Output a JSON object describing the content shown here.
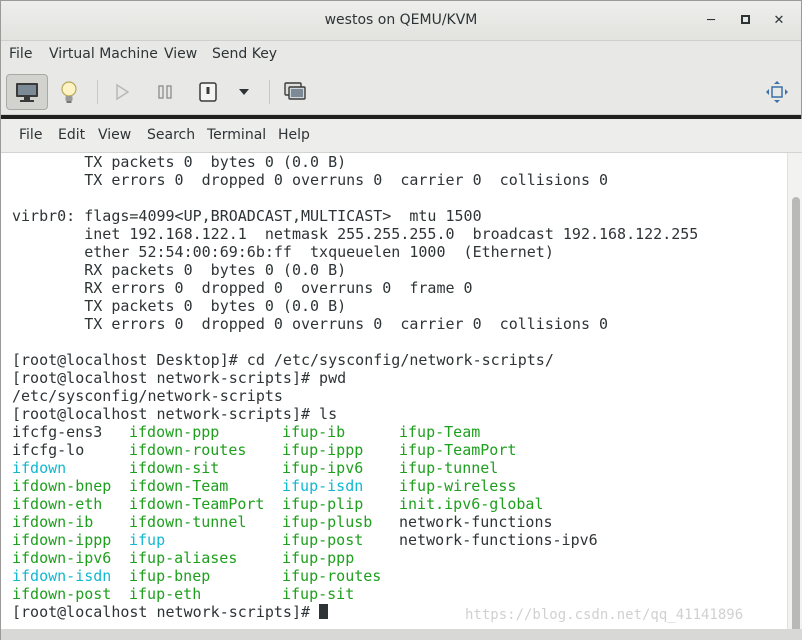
{
  "window": {
    "title": "westos on QEMU/KVM"
  },
  "menubar": {
    "items": [
      "File",
      "Virtual Machine",
      "View",
      "Send Key"
    ]
  },
  "terminal": {
    "menu": [
      "File",
      "Edit",
      "View",
      "Search",
      "Terminal",
      "Help"
    ],
    "lines": [
      "        TX packets 0  bytes 0 (0.0 B)",
      "        TX errors 0  dropped 0 overruns 0  carrier 0  collisions 0",
      "",
      "virbr0: flags=4099<UP,BROADCAST,MULTICAST>  mtu 1500",
      "        inet 192.168.122.1  netmask 255.255.255.0  broadcast 192.168.122.255",
      "        ether 52:54:00:69:6b:ff  txqueuelen 1000  (Ethernet)",
      "        RX packets 0  bytes 0 (0.0 B)",
      "        RX errors 0  dropped 0  overruns 0  frame 0",
      "        TX packets 0  bytes 0 (0.0 B)",
      "        TX errors 0  dropped 0 overruns 0  carrier 0  collisions 0",
      "",
      "[root@localhost Desktop]# cd /etc/sysconfig/network-scripts/",
      "[root@localhost network-scripts]# pwd",
      "/etc/sysconfig/network-scripts",
      "[root@localhost network-scripts]# ls"
    ],
    "ls_rows": [
      [
        {
          "t": "ifcfg-ens3",
          "c": "plain"
        },
        {
          "t": "ifdown-ppp",
          "c": "green"
        },
        {
          "t": "ifup-ib",
          "c": "green"
        },
        {
          "t": "ifup-Team",
          "c": "green"
        }
      ],
      [
        {
          "t": "ifcfg-lo",
          "c": "plain"
        },
        {
          "t": "ifdown-routes",
          "c": "green"
        },
        {
          "t": "ifup-ippp",
          "c": "green"
        },
        {
          "t": "ifup-TeamPort",
          "c": "green"
        }
      ],
      [
        {
          "t": "ifdown",
          "c": "cyan"
        },
        {
          "t": "ifdown-sit",
          "c": "green"
        },
        {
          "t": "ifup-ipv6",
          "c": "green"
        },
        {
          "t": "ifup-tunnel",
          "c": "green"
        }
      ],
      [
        {
          "t": "ifdown-bnep",
          "c": "green"
        },
        {
          "t": "ifdown-Team",
          "c": "green"
        },
        {
          "t": "ifup-isdn",
          "c": "cyan"
        },
        {
          "t": "ifup-wireless",
          "c": "green"
        }
      ],
      [
        {
          "t": "ifdown-eth",
          "c": "green"
        },
        {
          "t": "ifdown-TeamPort",
          "c": "green"
        },
        {
          "t": "ifup-plip",
          "c": "green"
        },
        {
          "t": "init.ipv6-global",
          "c": "green"
        }
      ],
      [
        {
          "t": "ifdown-ib",
          "c": "green"
        },
        {
          "t": "ifdown-tunnel",
          "c": "green"
        },
        {
          "t": "ifup-plusb",
          "c": "green"
        },
        {
          "t": "network-functions",
          "c": "plain"
        }
      ],
      [
        {
          "t": "ifdown-ippp",
          "c": "green"
        },
        {
          "t": "ifup",
          "c": "cyan"
        },
        {
          "t": "ifup-post",
          "c": "green"
        },
        {
          "t": "network-functions-ipv6",
          "c": "plain"
        }
      ],
      [
        {
          "t": "ifdown-ipv6",
          "c": "green"
        },
        {
          "t": "ifup-aliases",
          "c": "green"
        },
        {
          "t": "ifup-ppp",
          "c": "green"
        },
        {
          "t": "",
          "c": "plain"
        }
      ],
      [
        {
          "t": "ifdown-isdn",
          "c": "cyan"
        },
        {
          "t": "ifup-bnep",
          "c": "green"
        },
        {
          "t": "ifup-routes",
          "c": "green"
        },
        {
          "t": "",
          "c": "plain"
        }
      ],
      [
        {
          "t": "ifdown-post",
          "c": "green"
        },
        {
          "t": "ifup-eth",
          "c": "green"
        },
        {
          "t": "ifup-sit",
          "c": "green"
        },
        {
          "t": "",
          "c": "plain"
        }
      ]
    ],
    "prompt": "[root@localhost network-scripts]# "
  },
  "watermark": "https://blog.csdn.net/qq_41141896",
  "colors": {
    "ls_green": "#1ea01e",
    "ls_cyan": "#12b8d0",
    "terminal_bg": "#ffffff"
  },
  "icons": [
    "monitor-icon",
    "lightbulb-icon",
    "play-icon",
    "pause-icon",
    "power-icon",
    "chevron-down-icon",
    "screens-icon",
    "fullscreen-icon"
  ]
}
